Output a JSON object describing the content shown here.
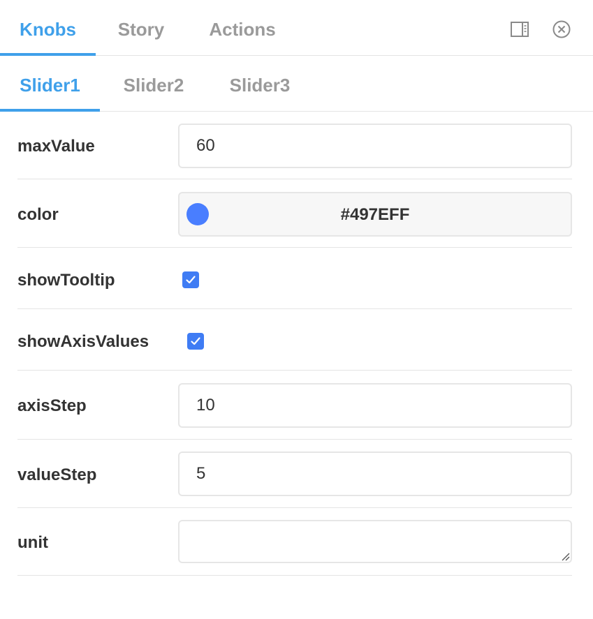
{
  "tabs": [
    {
      "label": "Knobs",
      "active": true
    },
    {
      "label": "Story",
      "active": false
    },
    {
      "label": "Actions",
      "active": false
    }
  ],
  "toolbar_icons": [
    "panel-layout-icon",
    "close-circle-icon"
  ],
  "subtabs": [
    {
      "label": "Slider1",
      "active": true
    },
    {
      "label": "Slider2",
      "active": false
    },
    {
      "label": "Slider3",
      "active": false
    }
  ],
  "knobs": {
    "maxValue": {
      "label": "maxValue",
      "value": "60"
    },
    "color": {
      "label": "color",
      "value": "#497EFF",
      "swatch": "#497EFF"
    },
    "showTooltip": {
      "label": "showTooltip",
      "checked": true
    },
    "showAxisValues": {
      "label": "showAxisValues",
      "checked": true
    },
    "axisStep": {
      "label": "axisStep",
      "value": "10"
    },
    "valueStep": {
      "label": "valueStep",
      "value": "5"
    },
    "unit": {
      "label": "unit",
      "value": ""
    }
  },
  "colors": {
    "accent": "#3fa0ea",
    "checkbox": "#3f7cf4",
    "inactive_tab": "#9a9a9a",
    "divider": "#e4e4e4"
  }
}
